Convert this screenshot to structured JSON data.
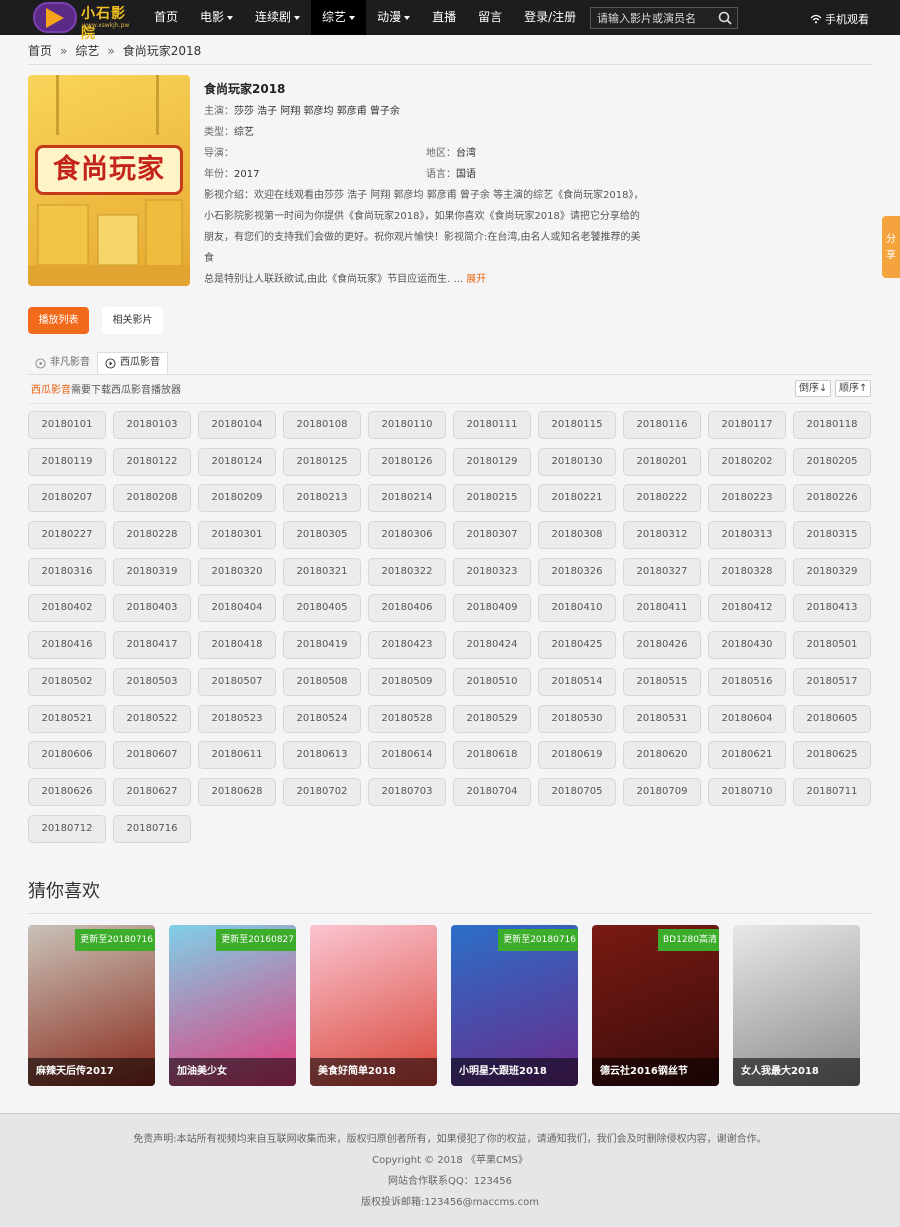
{
  "header": {
    "logo_text": "小石影院",
    "logo_sub": "www.xswkjh.pw",
    "nav": [
      {
        "label": "首页",
        "caret": false,
        "active": false
      },
      {
        "label": "电影",
        "caret": true,
        "active": false
      },
      {
        "label": "连续剧",
        "caret": true,
        "active": false
      },
      {
        "label": "综艺",
        "caret": true,
        "active": true
      },
      {
        "label": "动漫",
        "caret": true,
        "active": false
      },
      {
        "label": "直播",
        "caret": false,
        "active": false
      },
      {
        "label": "留言",
        "caret": false,
        "active": false
      },
      {
        "label": "登录/注册",
        "caret": false,
        "active": false
      }
    ],
    "search_placeholder": "请输入影片或演员名",
    "mobile_label": "手机观看"
  },
  "breadcrumb": [
    "首页",
    "综艺",
    "食尚玩家2018"
  ],
  "breadcrumb_sep": "»",
  "poster": {
    "title": "食尚玩家"
  },
  "info": {
    "title": "食尚玩家2018",
    "cast_label": "主演：",
    "cast": "莎莎 浩子 阿翔 郭彦均 郭彦甫 曾子余",
    "type_label": "类型：",
    "type": "综艺",
    "director_label": "导演：",
    "director": "",
    "region_label": "地区：",
    "region": "台湾",
    "year_label": "年份：",
    "year": "2017",
    "lang_label": "语言：",
    "lang": "国语",
    "intro_1": "影视介绍：欢迎在线观看由莎莎 浩子 阿翔 郭彦均 郭彦甫 曾子余 等主演的综艺《食尚玩家2018》，",
    "intro_2": "小石影院影视第一时间为你提供《食尚玩家2018》，如果你喜欢《食尚玩家2018》请把它分享给的",
    "intro_3": "朋友，有您们的支持我们会做的更好。祝你观片愉快！影视简介:在台湾,由名人或知名老饕推荐的美食",
    "intro_4": "总是特别让人联跃欲试,由此《食尚玩家》节目应运而生. ... ",
    "more": "展开"
  },
  "tabs": {
    "playlist": "播放列表",
    "related": "相关影片"
  },
  "sources": [
    {
      "label": "非凡影音",
      "active": false
    },
    {
      "label": "西瓜影音",
      "active": true
    }
  ],
  "note": {
    "highlight": "西瓜影音",
    "text": "需要下载西瓜影音播放器"
  },
  "sort": {
    "desc": "倒序↓",
    "asc": "顺序↑"
  },
  "episodes": [
    "20180101",
    "20180103",
    "20180104",
    "20180108",
    "20180110",
    "20180111",
    "20180115",
    "20180116",
    "20180117",
    "20180118",
    "20180119",
    "20180122",
    "20180124",
    "20180125",
    "20180126",
    "20180129",
    "20180130",
    "20180201",
    "20180202",
    "20180205",
    "20180207",
    "20180208",
    "20180209",
    "20180213",
    "20180214",
    "20180215",
    "20180221",
    "20180222",
    "20180223",
    "20180226",
    "20180227",
    "20180228",
    "20180301",
    "20180305",
    "20180306",
    "20180307",
    "20180308",
    "20180312",
    "20180313",
    "20180315",
    "20180316",
    "20180319",
    "20180320",
    "20180321",
    "20180322",
    "20180323",
    "20180326",
    "20180327",
    "20180328",
    "20180329",
    "20180402",
    "20180403",
    "20180404",
    "20180405",
    "20180406",
    "20180409",
    "20180410",
    "20180411",
    "20180412",
    "20180413",
    "20180416",
    "20180417",
    "20180418",
    "20180419",
    "20180423",
    "20180424",
    "20180425",
    "20180426",
    "20180430",
    "20180501",
    "20180502",
    "20180503",
    "20180507",
    "20180508",
    "20180509",
    "20180510",
    "20180514",
    "20180515",
    "20180516",
    "20180517",
    "20180521",
    "20180522",
    "20180523",
    "20180524",
    "20180528",
    "20180529",
    "20180530",
    "20180531",
    "20180604",
    "20180605",
    "20180606",
    "20180607",
    "20180611",
    "20180613",
    "20180614",
    "20180618",
    "20180619",
    "20180620",
    "20180621",
    "20180625",
    "20180626",
    "20180627",
    "20180628",
    "20180702",
    "20180703",
    "20180704",
    "20180705",
    "20180709",
    "20180710",
    "20180711",
    "20180712",
    "20180716"
  ],
  "recommend": {
    "title": "猜你喜欢",
    "items": [
      {
        "name": "麻辣天后传2017",
        "badge": "更新至20180716",
        "color1": "#c9c2b8",
        "color2": "#8a2a1c"
      },
      {
        "name": "加油美少女",
        "badge": "更新至20160827",
        "color1": "#7fd0e8",
        "color2": "#e23a7a"
      },
      {
        "name": "美食好简单2018",
        "badge": "",
        "color1": "#fbc4d0",
        "color2": "#d8463a"
      },
      {
        "name": "小明星大跟班2018",
        "badge": "更新至20180716",
        "color1": "#2b6fc8",
        "color2": "#6a2a8a"
      },
      {
        "name": "德云社2016钢丝节",
        "badge": "BD1280高清",
        "color1": "#7a1a14",
        "color2": "#3a0c0a"
      },
      {
        "name": "女人我最大2018",
        "badge": "",
        "color1": "#e8e8e8",
        "color2": "#8a8a8a"
      }
    ]
  },
  "footer": {
    "disclaimer": "免责声明:本站所有视频均来自互联网收集而来，版权归原创者所有，如果侵犯了你的权益，请通知我们，我们会及时删除侵权内容，谢谢合作。",
    "copyright": "Copyright © 2018 《苹果CMS》",
    "qq": "网站合作联系QQ：123456",
    "email": "版权投诉邮箱:123456@maccms.com"
  },
  "share_label": "分享",
  "colors": {
    "accent": "#f26a1b",
    "header_bg": "#1d1d1f",
    "badge_green": "#3cad2a"
  }
}
